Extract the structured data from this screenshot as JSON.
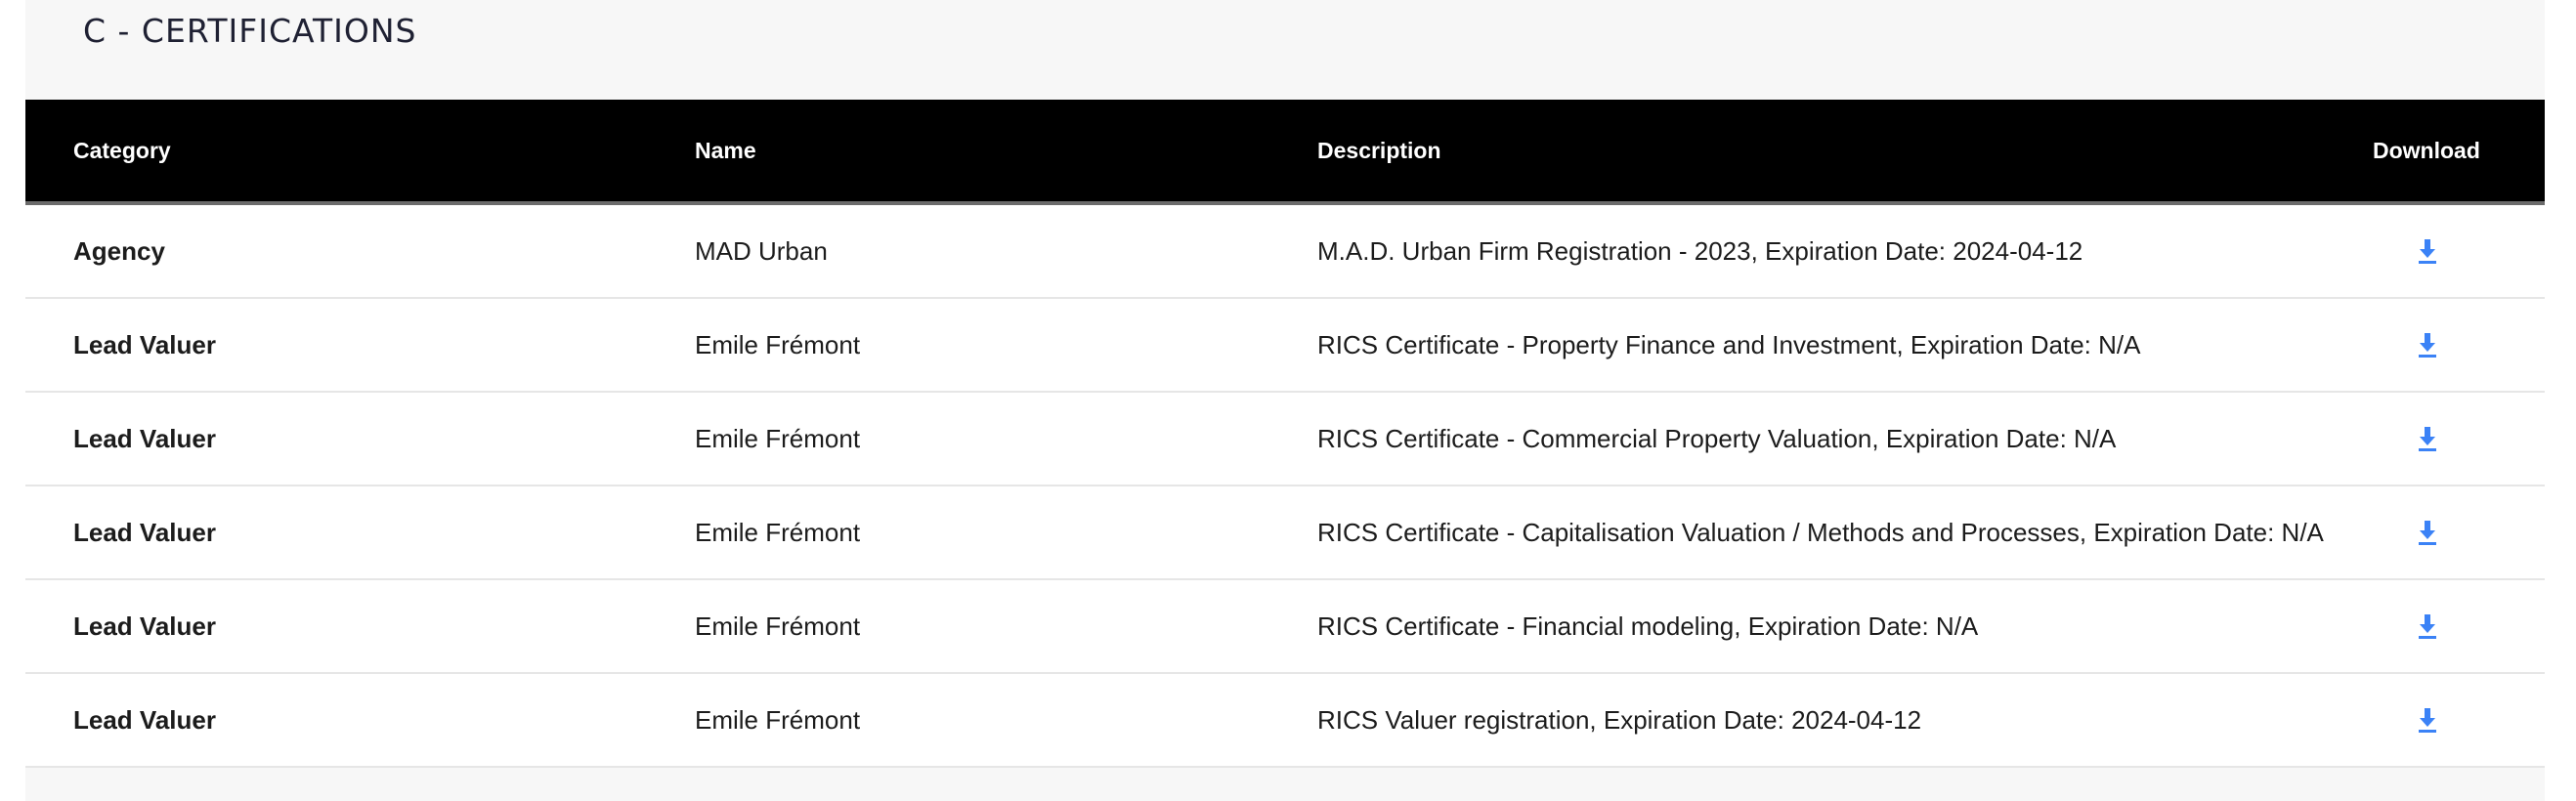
{
  "section": {
    "title": "C - CERTIFICATIONS"
  },
  "table": {
    "headers": {
      "category": "Category",
      "name": "Name",
      "description": "Description",
      "download": "Download"
    },
    "rows": [
      {
        "category": "Agency",
        "name": "MAD Urban",
        "description": "M.A.D. Urban Firm Registration - 2023, Expiration Date: 2024-04-12",
        "download_icon": "download-icon"
      },
      {
        "category": "Lead Valuer",
        "name": "Emile Frémont",
        "description": "RICS Certificate - Property Finance and Investment, Expiration Date: N/A",
        "download_icon": "download-icon"
      },
      {
        "category": "Lead Valuer",
        "name": "Emile Frémont",
        "description": "RICS Certificate - Commercial Property Valuation, Expiration Date: N/A",
        "download_icon": "download-icon"
      },
      {
        "category": "Lead Valuer",
        "name": "Emile Frémont",
        "description": "RICS Certificate - Capitalisation Valuation / Methods and Processes, Expiration Date: N/A",
        "download_icon": "download-icon"
      },
      {
        "category": "Lead Valuer",
        "name": "Emile Frémont",
        "description": "RICS Certificate - Financial modeling, Expiration Date: N/A",
        "download_icon": "download-icon"
      },
      {
        "category": "Lead Valuer",
        "name": "Emile Frémont",
        "description": "RICS Valuer registration, Expiration Date: 2024-04-12",
        "download_icon": "download-icon"
      }
    ]
  },
  "colors": {
    "header_bg": "#000000",
    "header_text": "#ffffff",
    "icon_accent": "#3b82f6",
    "section_bg": "#f7f7f7"
  }
}
